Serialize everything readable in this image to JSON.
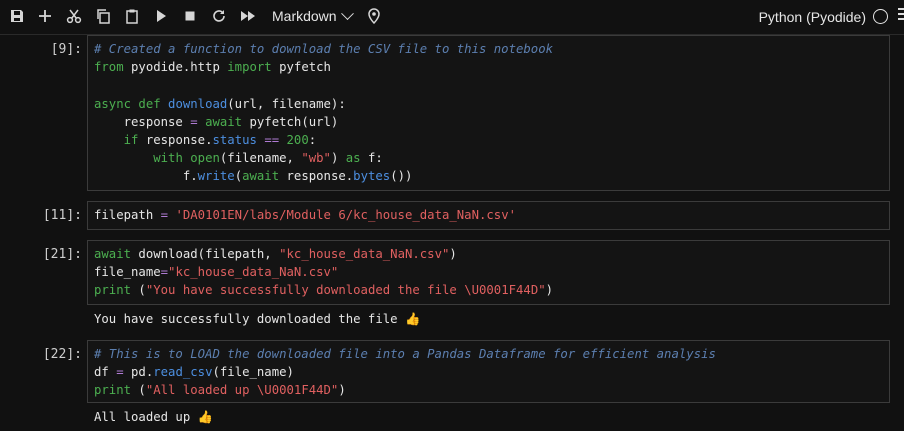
{
  "toolbar": {
    "buttons": [
      "save-icon",
      "add-cell-icon",
      "cut-icon",
      "copy-icon",
      "paste-icon",
      "run-icon",
      "stop-icon",
      "restart-icon",
      "fast-forward-icon"
    ],
    "cell_type": "Markdown",
    "kernel": "Python (Pyodide)"
  },
  "cells": [
    {
      "prompt": "[9]:",
      "lines": [
        "# Created a function to download the CSV file to this notebook",
        "from pyodide.http import pyfetch",
        "",
        "async def download(url, filename):",
        "    response = await pyfetch(url)",
        "    if response.status == 200:",
        "        with open(filename, \"wb\") as f:",
        "            f.write(await response.bytes())"
      ]
    },
    {
      "prompt": "[11]:",
      "lines": [
        "filepath = 'DA0101EN/labs/Module 6/kc_house_data_NaN.csv'"
      ]
    },
    {
      "prompt": "[21]:",
      "lines": [
        "await download(filepath, \"kc_house_data_NaN.csv\")",
        "file_name=\"kc_house_data_NaN.csv\"",
        "print (\"You have successfully downloaded the file \\U0001F44D\")"
      ],
      "output": "You have successfully downloaded the file 👍"
    },
    {
      "prompt": "[22]:",
      "lines": [
        "# This is to LOAD the downloaded file into a Pandas Dataframe for efficient analysis",
        "df = pd.read_csv(file_name)",
        "print (\"All loaded up \\U0001F44D\")"
      ],
      "output": "All loaded up 👍"
    }
  ]
}
